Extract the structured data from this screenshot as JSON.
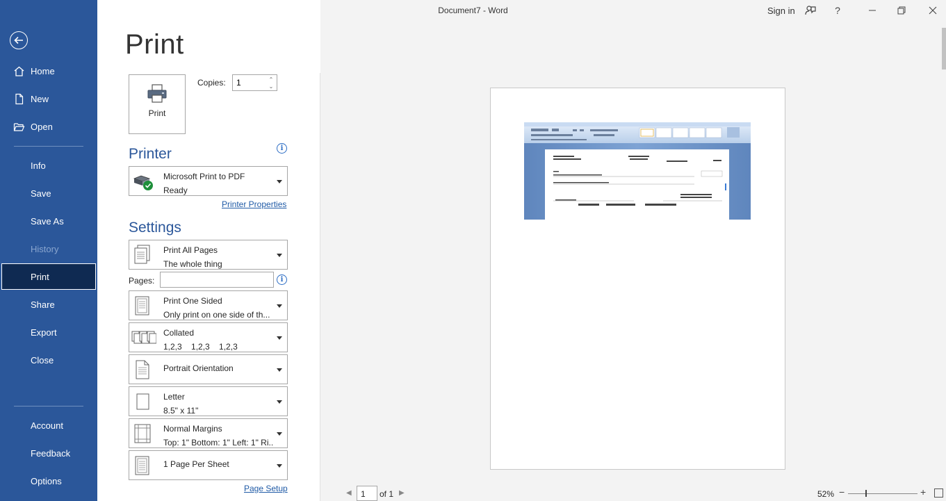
{
  "window": {
    "title": "Document7  -  Word",
    "sign_in": "Sign in",
    "help": "?"
  },
  "sidebar": {
    "items": [
      {
        "label": "Home"
      },
      {
        "label": "New"
      },
      {
        "label": "Open"
      },
      {
        "label": "Info"
      },
      {
        "label": "Save"
      },
      {
        "label": "Save As"
      },
      {
        "label": "History"
      },
      {
        "label": "Print"
      },
      {
        "label": "Share"
      },
      {
        "label": "Export"
      },
      {
        "label": "Close"
      },
      {
        "label": "Account"
      },
      {
        "label": "Feedback"
      },
      {
        "label": "Options"
      }
    ],
    "active": "Print",
    "disabled": "History"
  },
  "print": {
    "heading": "Print",
    "button_label": "Print",
    "copies_label": "Copies:",
    "copies_value": "1"
  },
  "printer": {
    "heading": "Printer",
    "name": "Microsoft Print to PDF",
    "status": "Ready",
    "properties_link": "Printer Properties"
  },
  "settings": {
    "heading": "Settings",
    "pages_label": "Pages:",
    "pages_value": "",
    "options": [
      {
        "line1": "Print All Pages",
        "line2": "The whole thing"
      },
      {
        "line1": "Print One Sided",
        "line2": "Only print on one side of th..."
      },
      {
        "line1": "Collated",
        "line2": "1,2,3    1,2,3    1,2,3"
      },
      {
        "line1": "Portrait Orientation",
        "line2": ""
      },
      {
        "line1": "Letter",
        "line2": "8.5\" x 11\""
      },
      {
        "line1": "Normal Margins",
        "line2": "Top: 1\" Bottom: 1\" Left: 1\" Ri..."
      },
      {
        "line1": "1 Page Per Sheet",
        "line2": ""
      }
    ],
    "page_setup_link": "Page Setup"
  },
  "preview": {
    "current_page": "1",
    "of_pages": "of 1",
    "zoom": "52%"
  },
  "colors": {
    "sidebar": "#2b579a",
    "active_item": "#0f2a52",
    "accent": "#2b579a"
  }
}
